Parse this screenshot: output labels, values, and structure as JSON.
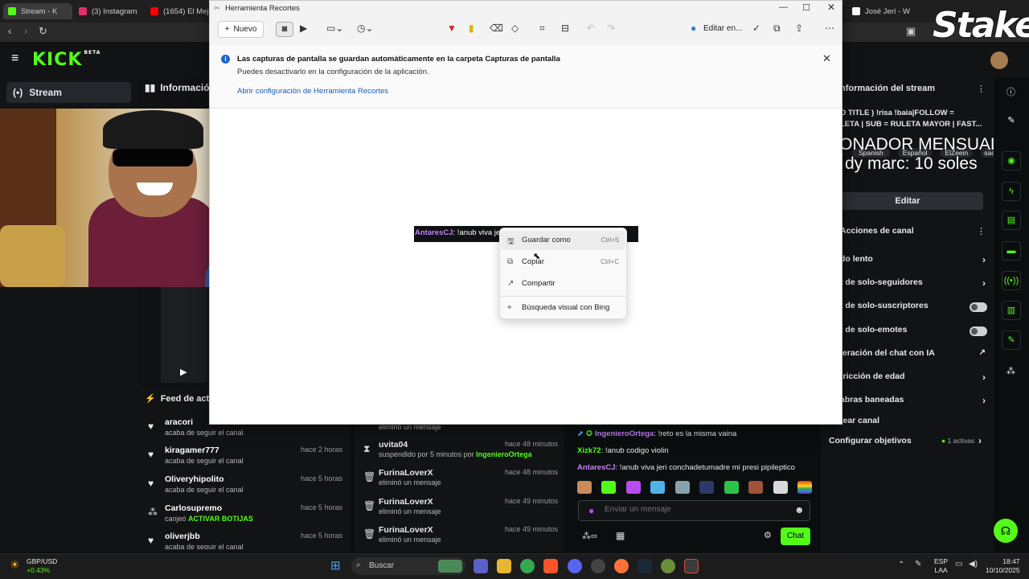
{
  "browser": {
    "tabs": [
      {
        "label": "Stream - K",
        "color": "#53fc18"
      },
      {
        "label": "(3) Instagram",
        "color": "#e1306c"
      },
      {
        "label": "(1654) El Mejo",
        "color": "#ff0000"
      },
      {
        "label": "José Jerí - Wiki",
        "color": "#ffffff"
      }
    ]
  },
  "kick": {
    "logo": "KICK",
    "logo_sup": "BETA",
    "nav_stream": "Stream",
    "info_header": "Información de",
    "activity_title": "Feed de activi",
    "activity": [
      {
        "name": "aracori",
        "sub": "acaba de seguir el canal",
        "time": ""
      },
      {
        "name": "kiragamer777",
        "sub": "acaba de seguir el canal",
        "time": "hace 2 horas"
      },
      {
        "name": "Oliveryhipolito",
        "sub": "acaba de seguir el canal",
        "time": "hace 5 horas"
      },
      {
        "name": "Carlosupremo",
        "sub_pre": "canjeó ",
        "sub_hl": "ACTIVAR BOTIJAS",
        "time": "hace 5 horas"
      },
      {
        "name": "oliverjbb",
        "sub": "acaba de seguir el canal",
        "time": "hace 5 horas"
      }
    ],
    "modlog": [
      {
        "name": "",
        "sub": "eliminó un mensaje",
        "time": ""
      },
      {
        "name": "uvita04",
        "sub_pre": "suspendido por 5 minutos por ",
        "sub_hl": "IngenieroOrtega",
        "time": "hace 48 minutos"
      },
      {
        "name": "FurinaLoverX",
        "sub": "eliminó un mensaje",
        "time": "hace 48 minutos"
      },
      {
        "name": "FurinaLoverX",
        "sub": "eliminó un mensaje",
        "time": "hace 49 minutos"
      },
      {
        "name": "FurinaLoverX",
        "sub": "eliminó un mensaje",
        "time": "hace 49 minutos"
      }
    ],
    "chat": [
      {
        "user": "IngenieroOrtega",
        "msg": ": !reto es la misma vaina",
        "color": "p"
      },
      {
        "user": "Xizk72",
        "msg": ": !anub codigo violin",
        "color": "g"
      },
      {
        "user": "AntaresCJ",
        "msg": ": !anub viva jeri conchadetumadre mi presi pipileptico",
        "color": "p"
      }
    ],
    "chat_placeholder": "Enviar un mensaje",
    "chat_button": "Chat",
    "right": {
      "stream_info": "nformación del stream",
      "title_line1": "O TITLE ) !risa !baia|FOLLOW =",
      "title_line2": "LETA | SUB = RULETA MAYOR | FAST...",
      "tags": [
        "Spanish",
        "Español",
        "ElZeein",
        "sach"
      ],
      "edit": "Editar",
      "actions_title": "Acciones de canal",
      "rows": [
        {
          "label": "do lento",
          "kind": "chev"
        },
        {
          "label": "t de solo-seguidores",
          "kind": "chev"
        },
        {
          "label": "t de solo-suscriptores",
          "kind": "tog"
        },
        {
          "label": "t de solo-emotes",
          "kind": "tog"
        },
        {
          "label": "leración del chat con IA",
          "kind": "ext"
        },
        {
          "label": "tricción de edad",
          "kind": "chev"
        },
        {
          "label": "abras baneadas",
          "kind": "chev"
        },
        {
          "label": "tear canal",
          "kind": "none"
        }
      ],
      "goals_label": "Configurar objetivos",
      "goals_status": "1 activas"
    },
    "overlay_donor_line1": "DONADOR MENSUAL:",
    "overlay_donor_line2": "dy marc: 10 soles",
    "stake": "Stake"
  },
  "snip": {
    "title": "Herramienta Recortes",
    "new_label": "Nuevo",
    "edit_in": "Editar en...",
    "banner_title": "Las capturas de pantalla se guardan automáticamente en la carpeta Capturas de pantalla",
    "banner_sub": "Puedes desactivarlo en la configuración de la aplicación.",
    "banner_link": "Abrir configuración de Herramienta Recortes",
    "capture_user": "AntaresCJ",
    "capture_msg": ": !anub viva jeri",
    "menu": [
      {
        "label": "Guardar como",
        "key": "Ctrl+S",
        "icon": "save-icon",
        "glyph": "🖫"
      },
      {
        "label": "Copiar",
        "key": "Ctrl+C",
        "icon": "copy-icon",
        "glyph": "⧉"
      },
      {
        "label": "Compartir",
        "key": "",
        "icon": "share-icon",
        "glyph": "↗"
      },
      {
        "label": "Búsqueda visual con Bing",
        "key": "",
        "icon": "visual-search-icon",
        "glyph": "⌖"
      }
    ]
  },
  "taskbar": {
    "ticker": "GBP/USD",
    "ticker_change": "+0.43%",
    "search": "Buscar",
    "lang": "ESP",
    "lang2": "LAA",
    "time": "18:47",
    "date": "10/10/2025"
  }
}
